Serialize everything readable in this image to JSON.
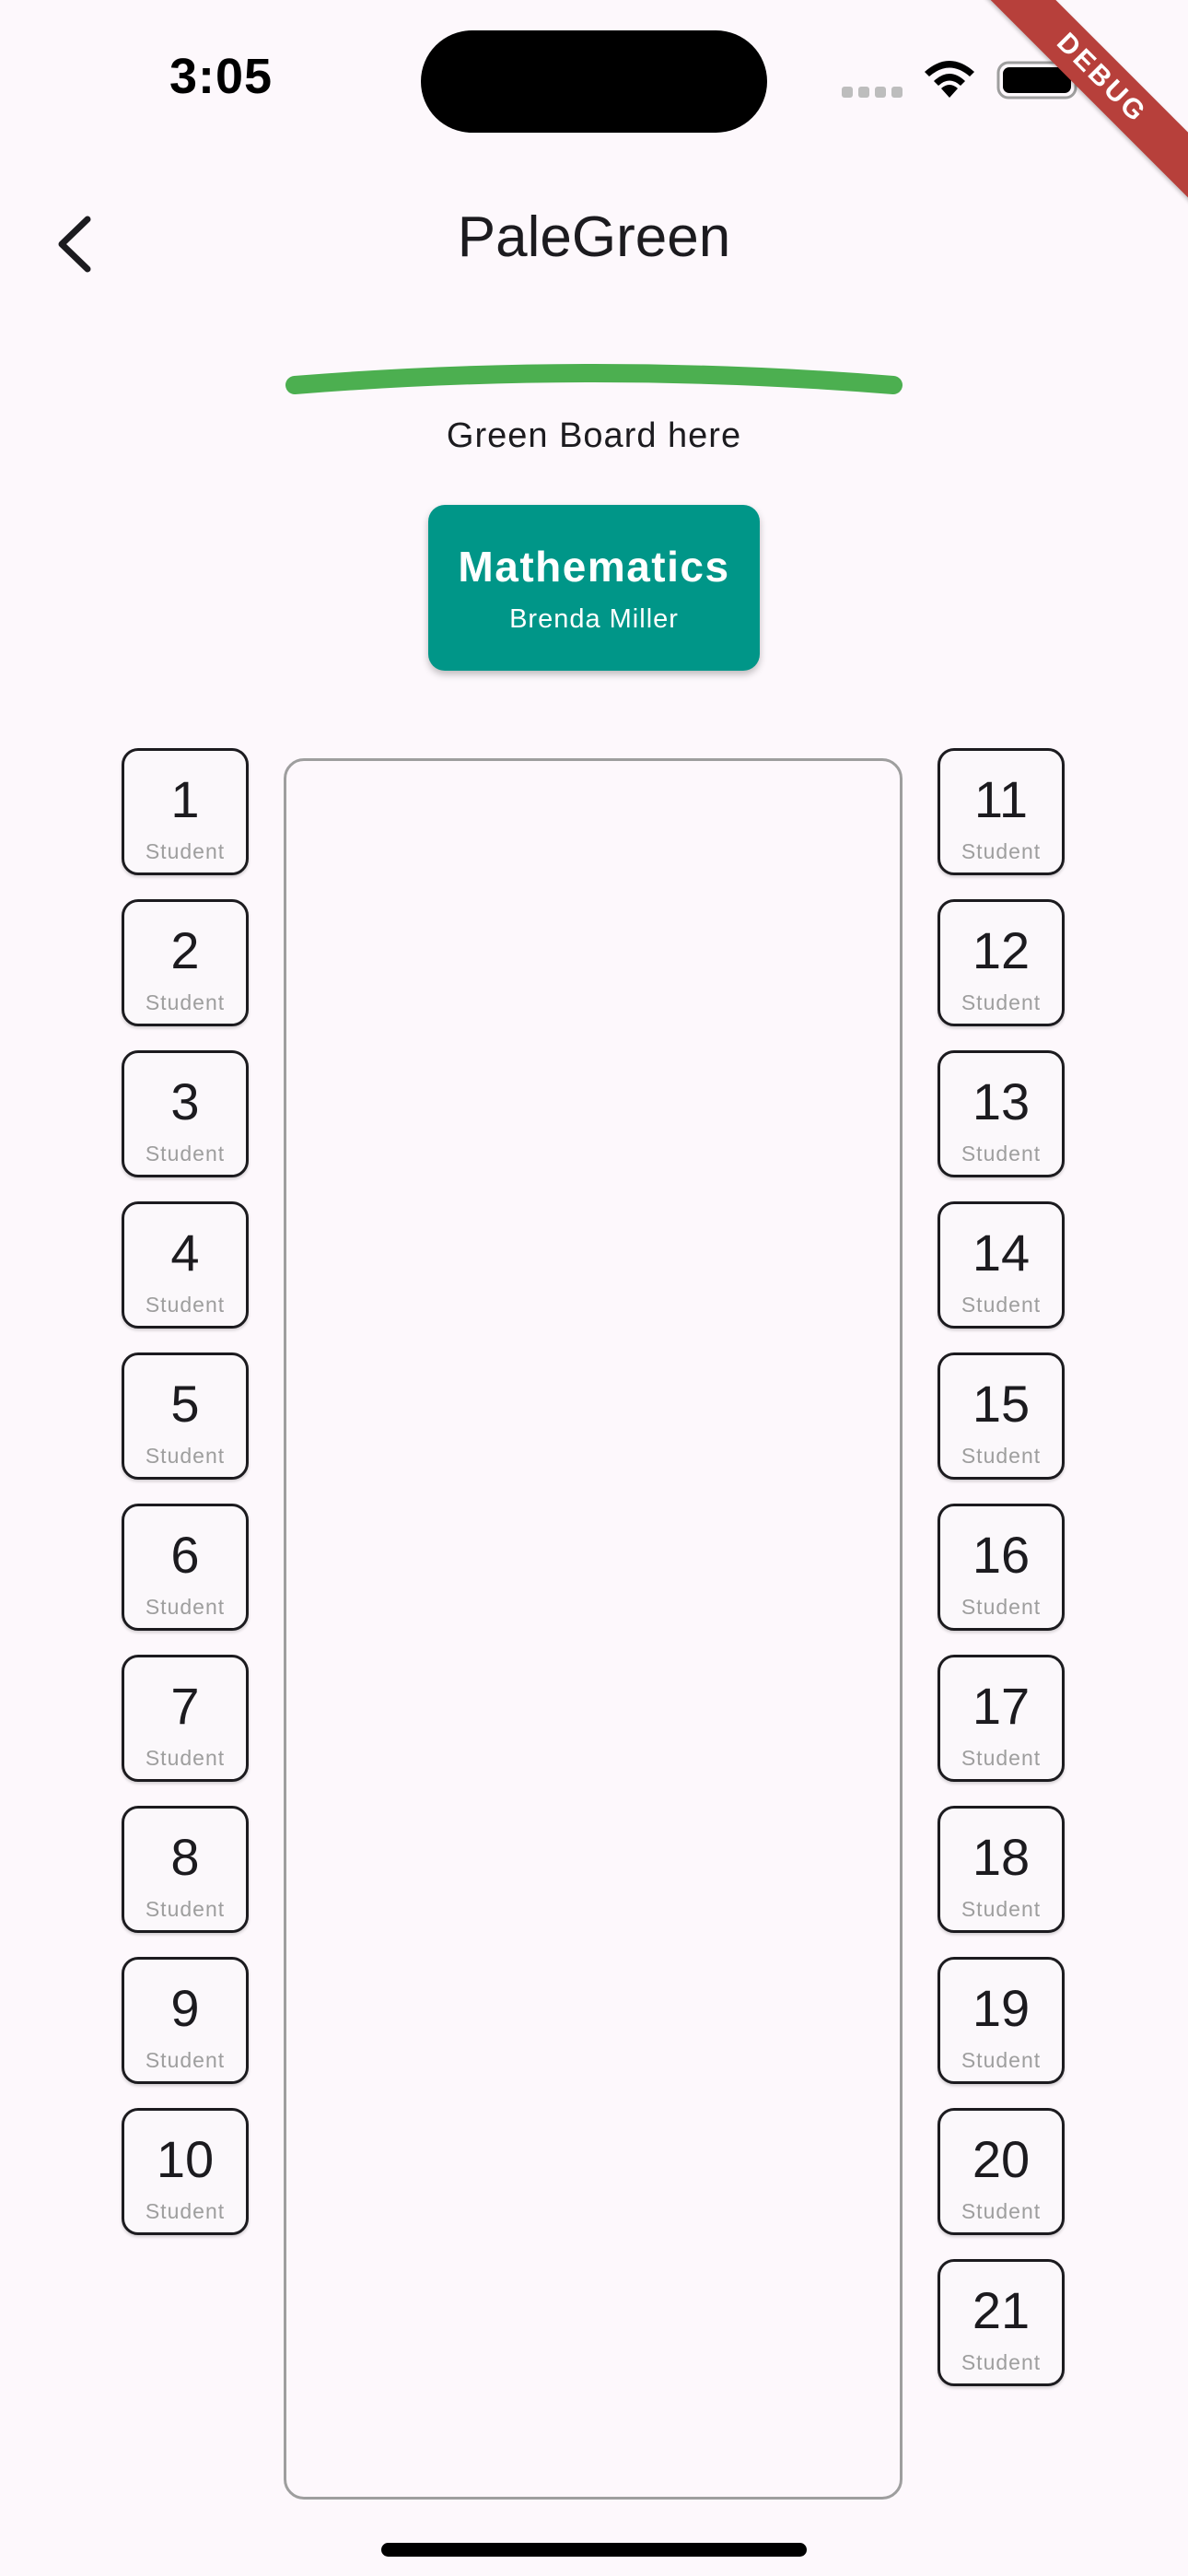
{
  "status_bar": {
    "time": "3:05",
    "debug_banner": "DEBUG"
  },
  "app_bar": {
    "title": "PaleGreen",
    "back_icon": "chevron-left-icon"
  },
  "board": {
    "label": "Green Board here",
    "color": "#4caf50"
  },
  "teacher": {
    "subject": "Mathematics",
    "name": "Brenda Miller",
    "color": "#009688"
  },
  "seats": {
    "left": [
      {
        "number": "1",
        "label": "Student"
      },
      {
        "number": "2",
        "label": "Student"
      },
      {
        "number": "3",
        "label": "Student"
      },
      {
        "number": "4",
        "label": "Student"
      },
      {
        "number": "5",
        "label": "Student"
      },
      {
        "number": "6",
        "label": "Student"
      },
      {
        "number": "7",
        "label": "Student"
      },
      {
        "number": "8",
        "label": "Student"
      },
      {
        "number": "9",
        "label": "Student"
      },
      {
        "number": "10",
        "label": "Student"
      }
    ],
    "right": [
      {
        "number": "11",
        "label": "Student"
      },
      {
        "number": "12",
        "label": "Student"
      },
      {
        "number": "13",
        "label": "Student"
      },
      {
        "number": "14",
        "label": "Student"
      },
      {
        "number": "15",
        "label": "Student"
      },
      {
        "number": "16",
        "label": "Student"
      },
      {
        "number": "17",
        "label": "Student"
      },
      {
        "number": "18",
        "label": "Student"
      },
      {
        "number": "19",
        "label": "Student"
      },
      {
        "number": "20",
        "label": "Student"
      },
      {
        "number": "21",
        "label": "Student"
      }
    ]
  }
}
